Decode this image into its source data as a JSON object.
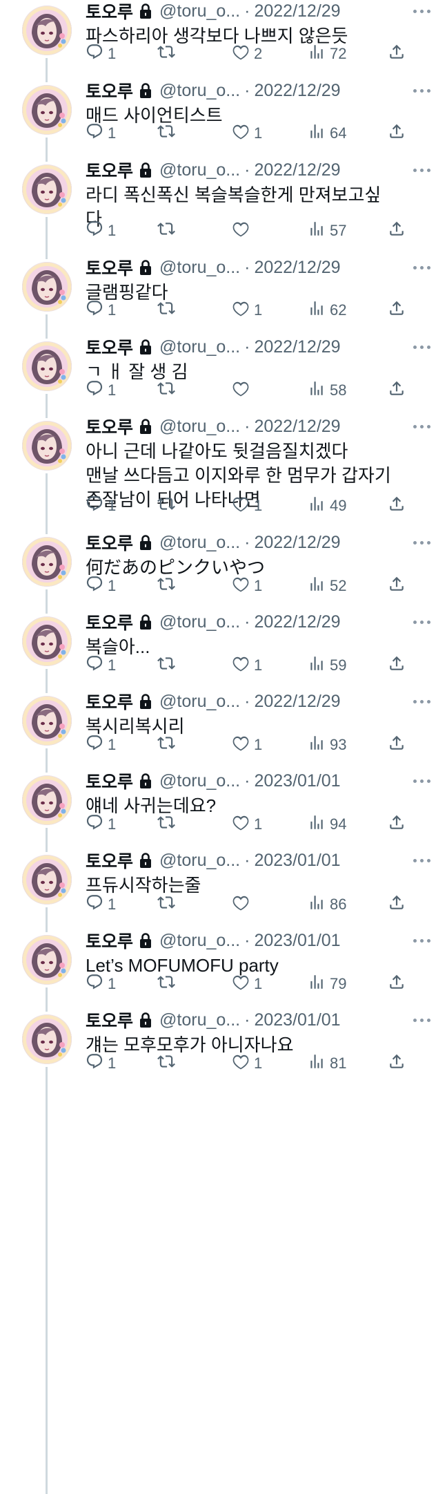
{
  "user": {
    "display_name": "토오루",
    "handle": "@toru_o..."
  },
  "tweets": [
    {
      "date": "2022/12/29",
      "text": "파스하리아 생각보다 나쁘지 않은듯",
      "replies": "1",
      "retweets": "",
      "likes": "2",
      "views": "72"
    },
    {
      "date": "2022/12/29",
      "text": "매드 사이언티스트",
      "replies": "1",
      "retweets": "",
      "likes": "1",
      "views": "64"
    },
    {
      "date": "2022/12/29",
      "text": "라디 폭신폭신 복슬복슬한게 만져보고싶\n다",
      "replies": "1",
      "retweets": "",
      "likes": "",
      "views": "57"
    },
    {
      "date": "2022/12/29",
      "text": "글램핑같다",
      "replies": "1",
      "retweets": "",
      "likes": "1",
      "views": "62"
    },
    {
      "date": "2022/12/29",
      "text": "ㄱ ㅐ 잘 생 김",
      "replies": "1",
      "retweets": "",
      "likes": "",
      "views": "58"
    },
    {
      "date": "2022/12/29",
      "text": "아니 근데 나같아도 뒷걸음질치겠다\n맨날 쓰다듬고 이지와루 한 멈무가 갑자기\n존잘남이 되어 나타나면",
      "replies": "1",
      "retweets": "",
      "likes": "1",
      "views": "49"
    },
    {
      "date": "2022/12/29",
      "text": "何だあのピンクいやつ",
      "replies": "1",
      "retweets": "",
      "likes": "1",
      "views": "52"
    },
    {
      "date": "2022/12/29",
      "text": "복슬아...",
      "replies": "1",
      "retweets": "",
      "likes": "1",
      "views": "59"
    },
    {
      "date": "2022/12/29",
      "text": "복시리복시리",
      "replies": "1",
      "retweets": "",
      "likes": "1",
      "views": "93"
    },
    {
      "date": "2023/01/01",
      "text": "얘네 사귀는데요?",
      "replies": "1",
      "retweets": "",
      "likes": "1",
      "views": "94"
    },
    {
      "date": "2023/01/01",
      "text": "프듀시작하는줄",
      "replies": "1",
      "retweets": "",
      "likes": "",
      "views": "86"
    },
    {
      "date": "2023/01/01",
      "text": "Let’s MOFUMOFU party",
      "replies": "1",
      "retweets": "",
      "likes": "1",
      "views": "79"
    },
    {
      "date": "2023/01/01",
      "text": "걔는 모후모후가 아니자나요",
      "replies": "1",
      "retweets": "",
      "likes": "1",
      "views": "81"
    }
  ],
  "icons": {
    "reply": "reply-icon",
    "retweet": "retweet-icon",
    "like": "heart-icon",
    "views": "views-icon",
    "share": "share-icon",
    "more": "more-icon",
    "lock": "lock-icon"
  },
  "colors": {
    "text": "#0f1419",
    "secondary": "#536471",
    "thread_line": "#cfd9de"
  }
}
